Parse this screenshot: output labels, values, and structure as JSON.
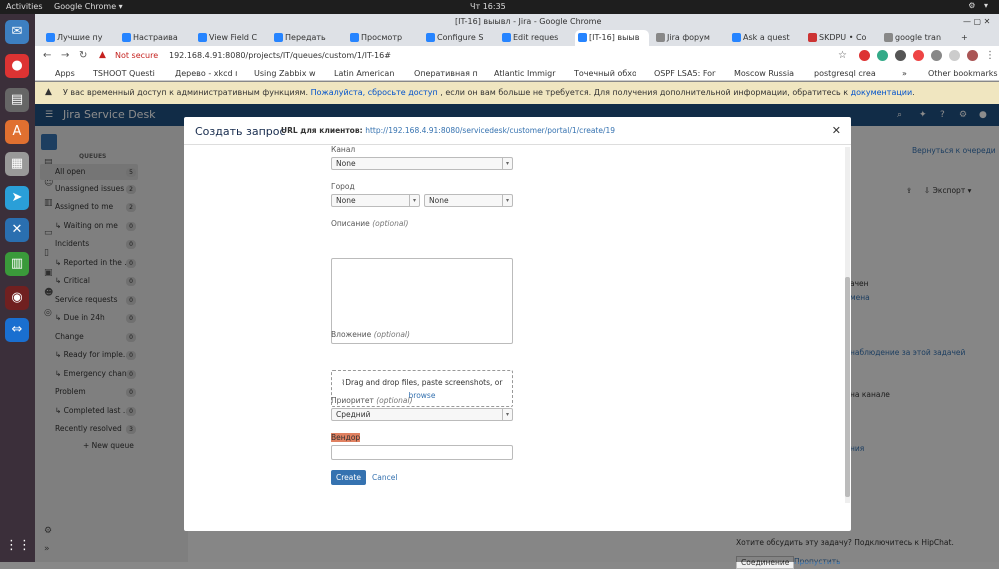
{
  "system_bar": {
    "activities": "Activities",
    "app": "Google Chrome ▾",
    "clock": "Чт 16:35",
    "tray": "⚙ ▾"
  },
  "browser": {
    "window_title": "[IT-16] выывл - Jira - Google Chrome",
    "tabs": [
      {
        "label": "Лучшие пу"
      },
      {
        "label": "Настраива"
      },
      {
        "label": "View Field C"
      },
      {
        "label": "Передать"
      },
      {
        "label": "Просмотр"
      },
      {
        "label": "Configure S"
      },
      {
        "label": "Edit reques"
      },
      {
        "label": "[IT-16] выыв"
      },
      {
        "label": "Jira форум"
      },
      {
        "label": "Ask a quest"
      },
      {
        "label": "SKDPU • Co"
      },
      {
        "label": "google tran"
      }
    ],
    "not_secure": "Not secure",
    "url": "192.168.4.91:8080/projects/IT/queues/custom/1/IT-16#",
    "bookmarks": [
      "Apps",
      "TSHOOT Questio",
      "Дерево - xkcd по",
      "Using Zabbix wit",
      "Latin American S",
      "Оперативная па",
      "Atlantic Immigra",
      "Точечный обход",
      "OSPF LSA5: Forw",
      "Moscow Russia E",
      "postgresql creat",
      "»",
      "Other bookmarks"
    ]
  },
  "infobar": {
    "text": "У вас временный доступ к административным функциям.",
    "link1": "Пожалуйста, сбросьте доступ",
    "text2": ", если он вам больше не требуется. Для получения дополнительной информации, обратитесь к",
    "link2": "документации",
    "end": "."
  },
  "jira": {
    "logo": "Jira Service Desk"
  },
  "sidebar": {
    "section": "QUEUES",
    "queues": [
      {
        "label": "All open",
        "count": "5"
      },
      {
        "label": "Unassigned issues",
        "count": "2"
      },
      {
        "label": "Assigned to me",
        "count": "2"
      },
      {
        "label": "↳ Waiting on me",
        "count": "0"
      },
      {
        "label": "Incidents",
        "count": "0"
      },
      {
        "label": "↳ Reported in the ...",
        "count": "0"
      },
      {
        "label": "↳ Critical",
        "count": "0"
      },
      {
        "label": "Service requests",
        "count": "0"
      },
      {
        "label": "↳ Due in 24h",
        "count": "0"
      },
      {
        "label": "Change",
        "count": "0"
      },
      {
        "label": "↳ Ready for imple...",
        "count": "0"
      },
      {
        "label": "↳ Emergency chan...",
        "count": "0"
      },
      {
        "label": "Problem",
        "count": "0"
      },
      {
        "label": "↳ Completed last ...",
        "count": "0"
      },
      {
        "label": "Recently resolved",
        "count": "3"
      }
    ],
    "new_queue": "+ New queue"
  },
  "background": {
    "back_link": "Вернуться к очереди",
    "export": "Экспорт",
    "r1": "ачен",
    "r2": "мена",
    "r3": "наблюдение за этой задачей",
    "r4": "на канале",
    "r5": "ния",
    "discuss": "Хотите обсудить эту задачу? Подключитесь к HipChat.",
    "connect": "Соединение",
    "skip": "Пропустить"
  },
  "modal": {
    "title": "Создать запрос",
    "url_label": "URL для клиентов:",
    "url": "http://192.168.4.91:8080/servicedesk/customer/portal/1/create/19",
    "channel_label": "Канал",
    "channel_value": "None",
    "city_label": "Город",
    "city_value1": "None",
    "city_value2": "None",
    "description_label": "Описание",
    "optional": "(optional)",
    "attachment_label": "Вложение",
    "attach_text": "Drag and drop files, paste screenshots, or",
    "attach_browse": "browse",
    "priority_label": "Приоритет",
    "priority_value": "Средний",
    "vendor_label": "Вендор",
    "create": "Create",
    "cancel": "Cancel"
  }
}
